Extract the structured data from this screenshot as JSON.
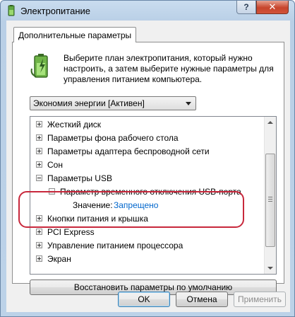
{
  "window": {
    "title": "Электропитание",
    "help_label": "?",
    "close_label": "✕"
  },
  "tab": {
    "label": "Дополнительные параметры"
  },
  "description": "Выберите план электропитания, который нужно настроить, а затем выберите нужные параметры для управления питанием компьютера.",
  "plan_select": {
    "value": "Экономия энергии [Активен]"
  },
  "tree": {
    "items": [
      {
        "label": "Жесткий диск",
        "expander": "+"
      },
      {
        "label": "Параметры фона рабочего стола",
        "expander": "+"
      },
      {
        "label": "Параметры адаптера беспроводной сети",
        "expander": "+"
      },
      {
        "label": "Сон",
        "expander": "+"
      },
      {
        "label": "Параметры USB",
        "expander": "−"
      },
      {
        "label": "Параметр временного отключения USB-порта",
        "expander": "−"
      },
      {
        "label": "Кнопки питания и крышка",
        "expander": "+"
      },
      {
        "label": "PCI Express",
        "expander": "+"
      },
      {
        "label": "Управление питанием процессора",
        "expander": "+"
      },
      {
        "label": "Экран",
        "expander": "+"
      }
    ],
    "value_row": {
      "label": "Значение:",
      "value": "Запрещено"
    }
  },
  "buttons": {
    "restore": "Восстановить параметры по умолчанию",
    "ok": "OK",
    "cancel": "Отмена",
    "apply": "Применить"
  },
  "colors": {
    "link": "#0066cc",
    "highlight_ring": "#c8283c"
  },
  "icons": [
    "battery-icon",
    "power-options-icon",
    "help-icon",
    "close-icon",
    "expand-icon",
    "collapse-icon",
    "scroll-up-icon",
    "scroll-down-icon"
  ]
}
